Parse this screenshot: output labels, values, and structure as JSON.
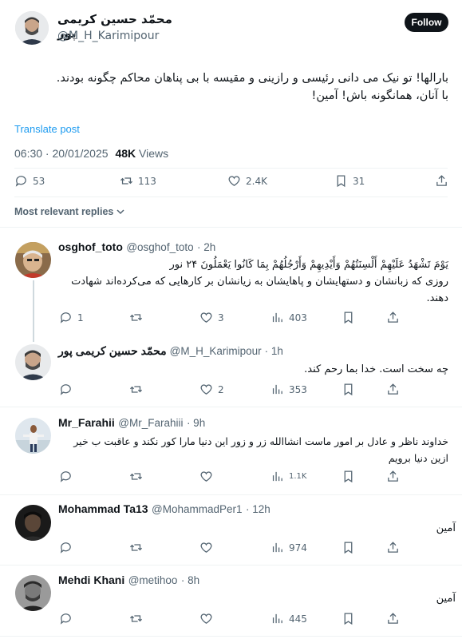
{
  "author": {
    "name": "محمّد حسین کریمی پور",
    "handle": "@M_H_Karimipour",
    "follow_label": "Follow"
  },
  "post": {
    "text_line1": "بارالها!  تو نیک می دانی رئیسی و رازینی و مقیسه با بی پناهان محاکم چگونه بودند.",
    "text_line2": "با آنان، همانگونه باش!  آمین!",
    "translate_label": "Translate post",
    "time": "06:30 · 20/01/2025",
    "views_count": "48K",
    "views_label": "Views",
    "replies": "53",
    "reposts": "113",
    "likes": "2.4K",
    "bookmarks": "31"
  },
  "sort_label": "Most relevant replies",
  "replies": [
    {
      "name": "osghof_toto",
      "handle": "@osghof_toto",
      "time": "· 2h",
      "text_line1": "يَوْمَ تَشْهَدُ عَلَيْهِمْ أَلْسِنَتُهُمْ وَأَيْدِيهِمْ وَأَرْجُلُهُمْ بِمَا كَانُوا يَعْمَلُونَ ۲۴ نور",
      "text_line2": "روزی که زبانشان و دستهایشان و پاهایشان به زیانشان بر کارهایی که می‌کرده‌اند شهادت",
      "text_line3": "دهند.",
      "replies": "1",
      "reposts": "",
      "likes": "3",
      "views": "403"
    },
    {
      "name": "محمّد حسین کریمی پور",
      "handle": "@M_H_Karimipour",
      "time": "· 1h",
      "text_line1": "چه سخت است.  خدا بما رحم کند.",
      "replies": "",
      "reposts": "",
      "likes": "2",
      "views": "353"
    },
    {
      "name": "Mr_Farahii",
      "handle": "@Mr_Farahiii",
      "time": "· 9h",
      "text_line1": "خداوند ناظر و عادل بر امور ماست انشاالله زر و زور این دنیا مارا کور نکند و عاقبت ب خیر",
      "text_line2": "ازین دنیا برویم",
      "replies": "",
      "reposts": "",
      "likes": "",
      "views": "1.1K"
    },
    {
      "name": "Mohammad Ta13",
      "handle": "@MohammadPer1",
      "time": "· 12h",
      "text_line1": "آمین",
      "replies": "",
      "reposts": "",
      "likes": "",
      "views": "974"
    },
    {
      "name": "Mehdi Khani",
      "handle": "@metihoo",
      "time": "· 8h",
      "text_line1": "آمین",
      "replies": "",
      "reposts": "",
      "likes": "",
      "views": "445"
    }
  ],
  "colors": {
    "link_blue": "#1d9bf0",
    "text_gray": "#536471",
    "divider": "#eff3f4",
    "follow_bg": "#0f1419"
  },
  "icons": [
    "reply-icon",
    "repost-icon",
    "like-icon",
    "bookmark-icon",
    "share-icon",
    "views-icon",
    "chevron-down-icon"
  ]
}
